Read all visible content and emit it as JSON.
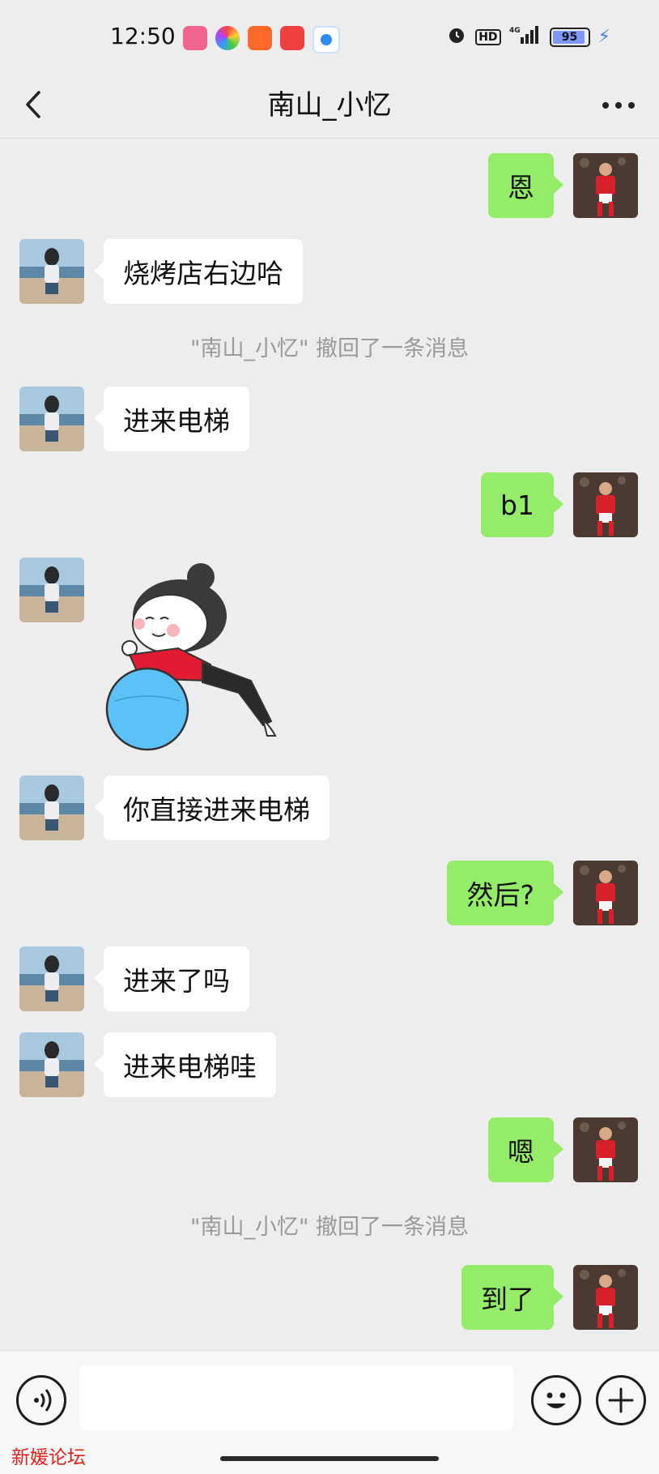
{
  "status_bar": {
    "time": "12:50",
    "battery": "95",
    "hd": "HD",
    "network": "4G",
    "app_icons": [
      "bilibili-app-icon",
      "colorful-app-icon",
      "shopping-app-icon",
      "toutiao-app-icon",
      "blue-circle-app-icon"
    ]
  },
  "header": {
    "title": "南山_小忆"
  },
  "messages": [
    {
      "side": "right",
      "type": "text",
      "text": "恩"
    },
    {
      "side": "left",
      "type": "text",
      "text": "烧烤店右边哈"
    },
    {
      "side": "center",
      "type": "recall",
      "text": "\"南山_小忆\" 撤回了一条消息"
    },
    {
      "side": "left",
      "type": "text",
      "text": "进来电梯"
    },
    {
      "side": "right",
      "type": "text",
      "text": "b1"
    },
    {
      "side": "left",
      "type": "sticker",
      "sticker": "girl-on-ball-sticker"
    },
    {
      "side": "left",
      "type": "text",
      "text": "你直接进来电梯"
    },
    {
      "side": "right",
      "type": "text",
      "text": "然后?"
    },
    {
      "side": "left",
      "type": "text",
      "text": "进来了吗"
    },
    {
      "side": "left",
      "type": "text",
      "text": "进来电梯哇"
    },
    {
      "side": "right",
      "type": "text",
      "text": "嗯"
    },
    {
      "side": "center",
      "type": "recall",
      "text": "\"南山_小忆\" 撤回了一条消息"
    },
    {
      "side": "right",
      "type": "text",
      "text": "到了"
    }
  ],
  "input_bar": {
    "watermark": "新媛论坛"
  },
  "colors": {
    "background": "#ededed",
    "bubble_right": "#95ec69",
    "bubble_left": "#ffffff",
    "recall_text": "#9a9a9a",
    "watermark": "#e0211b"
  }
}
